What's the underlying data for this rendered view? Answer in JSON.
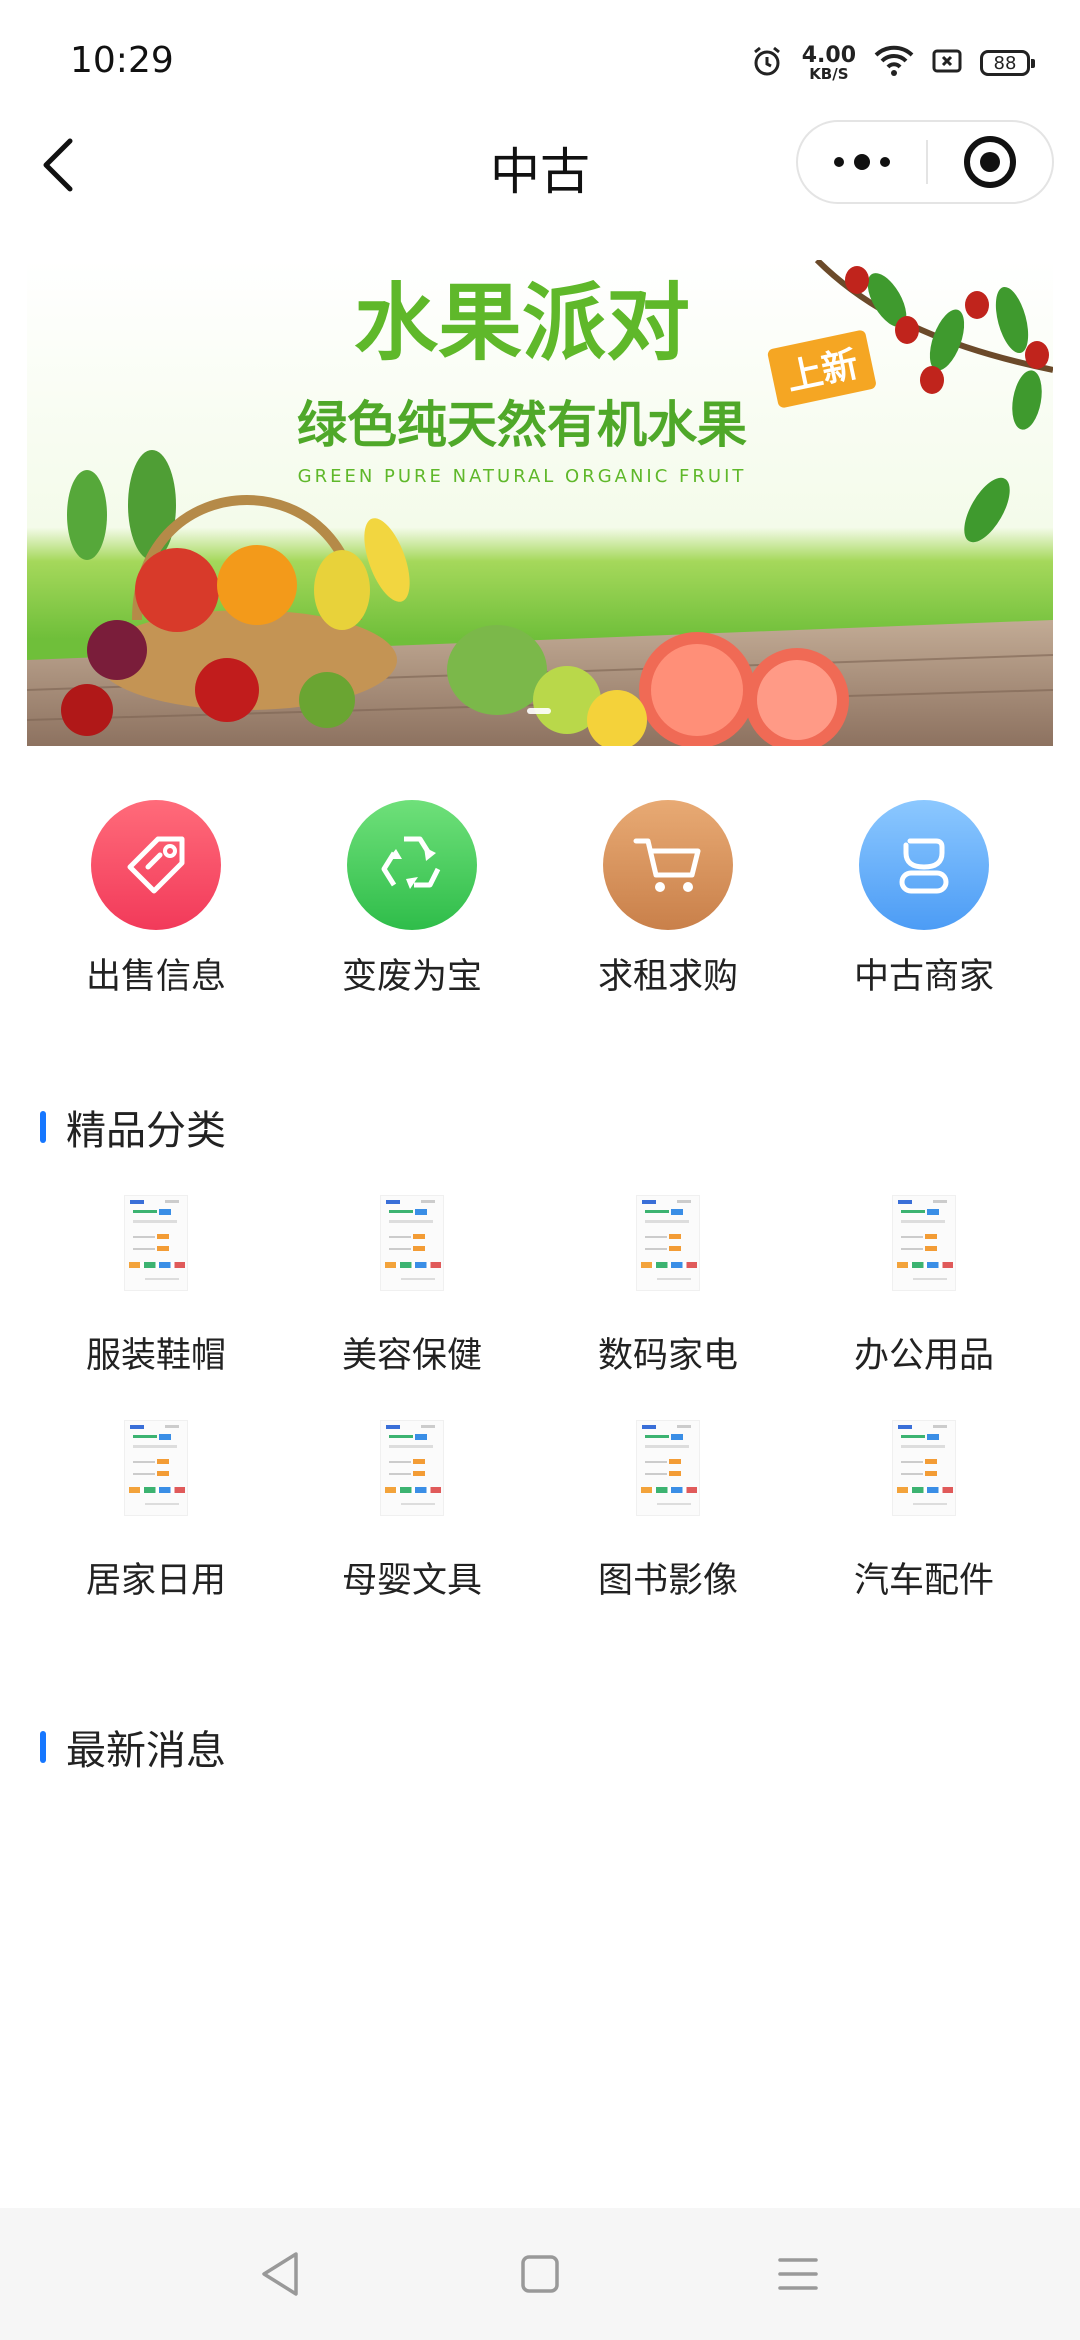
{
  "status_bar": {
    "time": "10:29",
    "net_speed_value": "4.00",
    "net_speed_unit": "KB/S",
    "battery": "88",
    "icons": [
      "alarm-icon",
      "wifi-icon",
      "sim-icon",
      "battery-icon"
    ]
  },
  "nav": {
    "title": "中古",
    "back_icon": "chevron-left-icon",
    "more_icon": "more-dots-icon",
    "close_icon": "target-close-icon"
  },
  "banner": {
    "title": "水果派对",
    "subtitle": "绿色纯天然有机水果",
    "english": "GREEN PURE NATURAL ORGANIC FRUIT",
    "tag": "上新",
    "active_slide": 1,
    "colors": {
      "title": "#5fb82a",
      "tag": "#f5a623",
      "sky": "#ffffff",
      "grass": "#7ac943",
      "deck": "#a88b73"
    }
  },
  "quick_menu": [
    {
      "label": "出售信息",
      "icon": "price-tag-icon",
      "color_top": "#ff6b7a",
      "color_bottom": "#f23a5a"
    },
    {
      "label": "变废为宝",
      "icon": "recycle-icon",
      "color_top": "#6fe07a",
      "color_bottom": "#2fbd4a"
    },
    {
      "label": "求租求购",
      "icon": "cart-icon",
      "color_top": "#e8aa74",
      "color_bottom": "#c9804a"
    },
    {
      "label": "中古商家",
      "icon": "merchant-icon",
      "color_top": "#8cc8ff",
      "color_bottom": "#4c9cf5"
    }
  ],
  "sections": {
    "categories_title": "精品分类",
    "news_title": "最新消息"
  },
  "categories": [
    {
      "label": "服装鞋帽"
    },
    {
      "label": "美容保健"
    },
    {
      "label": "数码家电"
    },
    {
      "label": "办公用品"
    },
    {
      "label": "居家日用"
    },
    {
      "label": "母婴文具"
    },
    {
      "label": "图书影像"
    },
    {
      "label": "汽车配件"
    }
  ],
  "accent_color": "#1677ff"
}
